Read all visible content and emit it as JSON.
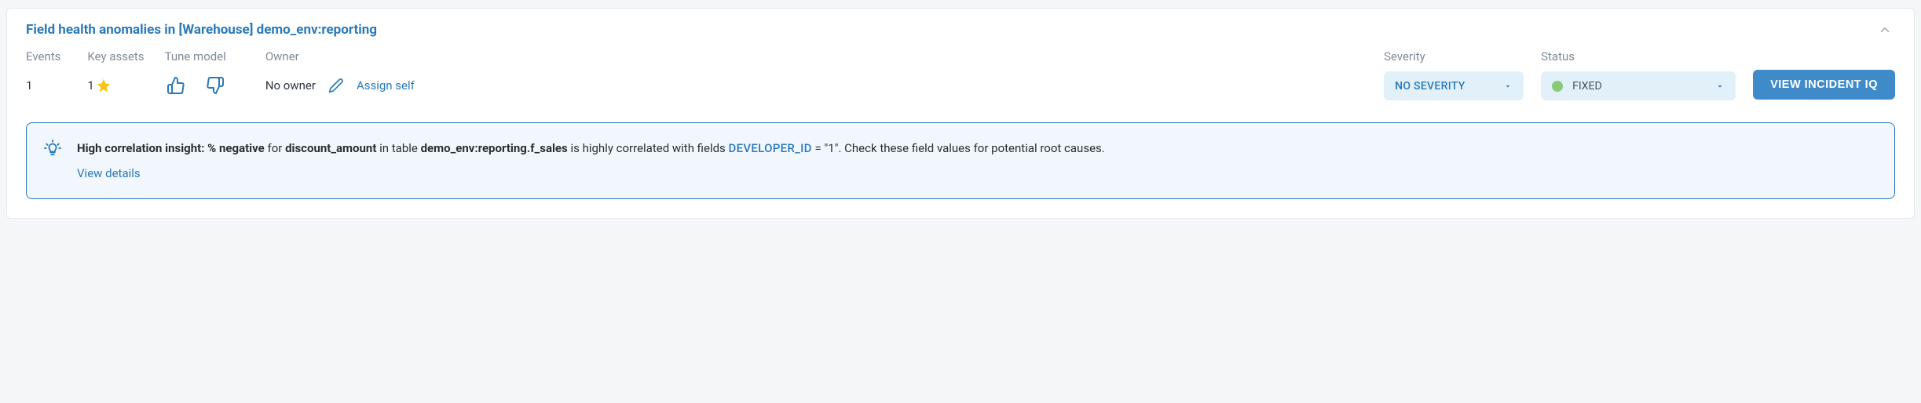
{
  "header": {
    "title": "Field health anomalies in [Warehouse] demo_env:reporting"
  },
  "meta": {
    "events_label": "Events",
    "events_value": "1",
    "keyassets_label": "Key assets",
    "keyassets_value": "1",
    "tune_label": "Tune model",
    "owner_label": "Owner",
    "owner_value": "No owner",
    "assign_self_label": "Assign self"
  },
  "severity": {
    "label": "Severity",
    "value": "NO SEVERITY"
  },
  "status": {
    "label": "Status",
    "value": "FIXED"
  },
  "cta": {
    "view_incident_iq": "VIEW INCIDENT IQ"
  },
  "insight": {
    "lead": "High correlation insight: % negative",
    "mid1": " for ",
    "field": "discount_amount",
    "mid2": " in table ",
    "table": "demo_env:reporting.f_sales",
    "mid3": " is highly correlated with fields ",
    "dev_id": "DEVELOPER_ID",
    "equals": " = \"1\"",
    "tail": ". Check these field values for potential root causes.",
    "view_details": "View details"
  }
}
